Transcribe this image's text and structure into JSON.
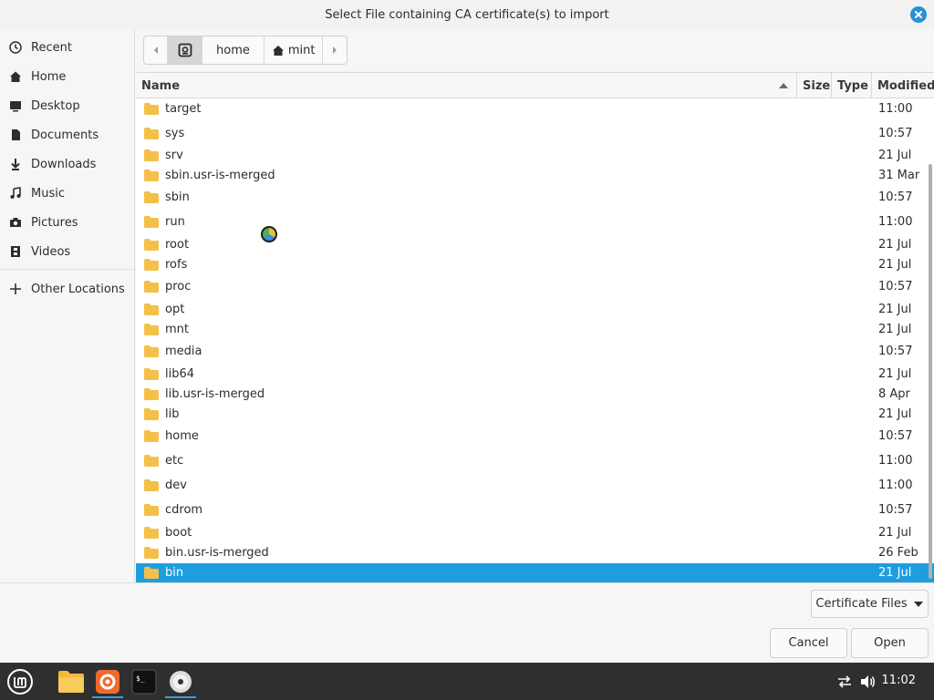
{
  "window": {
    "title": "Select File containing CA certificate(s) to import"
  },
  "sidebar": {
    "items": [
      {
        "label": "Recent",
        "icon": "clock-icon"
      },
      {
        "label": "Home",
        "icon": "home-icon"
      },
      {
        "label": "Desktop",
        "icon": "desktop-icon"
      },
      {
        "label": "Documents",
        "icon": "document-icon"
      },
      {
        "label": "Downloads",
        "icon": "download-icon"
      },
      {
        "label": "Music",
        "icon": "music-icon"
      },
      {
        "label": "Pictures",
        "icon": "camera-icon"
      },
      {
        "label": "Videos",
        "icon": "film-icon"
      }
    ],
    "other_locations": {
      "label": "Other Locations",
      "icon": "plus-icon"
    }
  },
  "pathbar": {
    "segments": [
      "home",
      "mint"
    ]
  },
  "columns": {
    "name": "Name",
    "size": "Size",
    "type": "Type",
    "modified": "Modified"
  },
  "files": [
    {
      "name": "target",
      "modified": "11:00"
    },
    {
      "name": "sys",
      "modified": "10:57"
    },
    {
      "name": "srv",
      "modified": "21 Jul"
    },
    {
      "name": "sbin.usr-is-merged",
      "modified": "31 Mar"
    },
    {
      "name": "sbin",
      "modified": "10:57"
    },
    {
      "name": "run",
      "modified": "11:00"
    },
    {
      "name": "root",
      "modified": "21 Jul"
    },
    {
      "name": "rofs",
      "modified": "21 Jul"
    },
    {
      "name": "proc",
      "modified": "10:57"
    },
    {
      "name": "opt",
      "modified": "21 Jul"
    },
    {
      "name": "mnt",
      "modified": "21 Jul"
    },
    {
      "name": "media",
      "modified": "10:57"
    },
    {
      "name": "lib64",
      "modified": "21 Jul"
    },
    {
      "name": "lib.usr-is-merged",
      "modified": "8 Apr"
    },
    {
      "name": "lib",
      "modified": "21 Jul"
    },
    {
      "name": "home",
      "modified": "10:57"
    },
    {
      "name": "etc",
      "modified": "11:00"
    },
    {
      "name": "dev",
      "modified": "11:00"
    },
    {
      "name": "cdrom",
      "modified": "10:57"
    },
    {
      "name": "boot",
      "modified": "21 Jul"
    },
    {
      "name": "bin.usr-is-merged",
      "modified": "26 Feb"
    },
    {
      "name": "bin",
      "modified": "21 Jul",
      "selected": true
    }
  ],
  "filter": {
    "label": "Certificate Files"
  },
  "buttons": {
    "cancel": "Cancel",
    "open": "Open"
  },
  "taskbar": {
    "clock": "11:02",
    "apps": [
      "mint-menu-icon",
      "files-icon",
      "firefox-icon",
      "terminal-icon",
      "disc-icon"
    ]
  },
  "colors": {
    "selection": "#1f9ede",
    "accent": "#2a8fd6",
    "folder": "#f5c04a"
  }
}
